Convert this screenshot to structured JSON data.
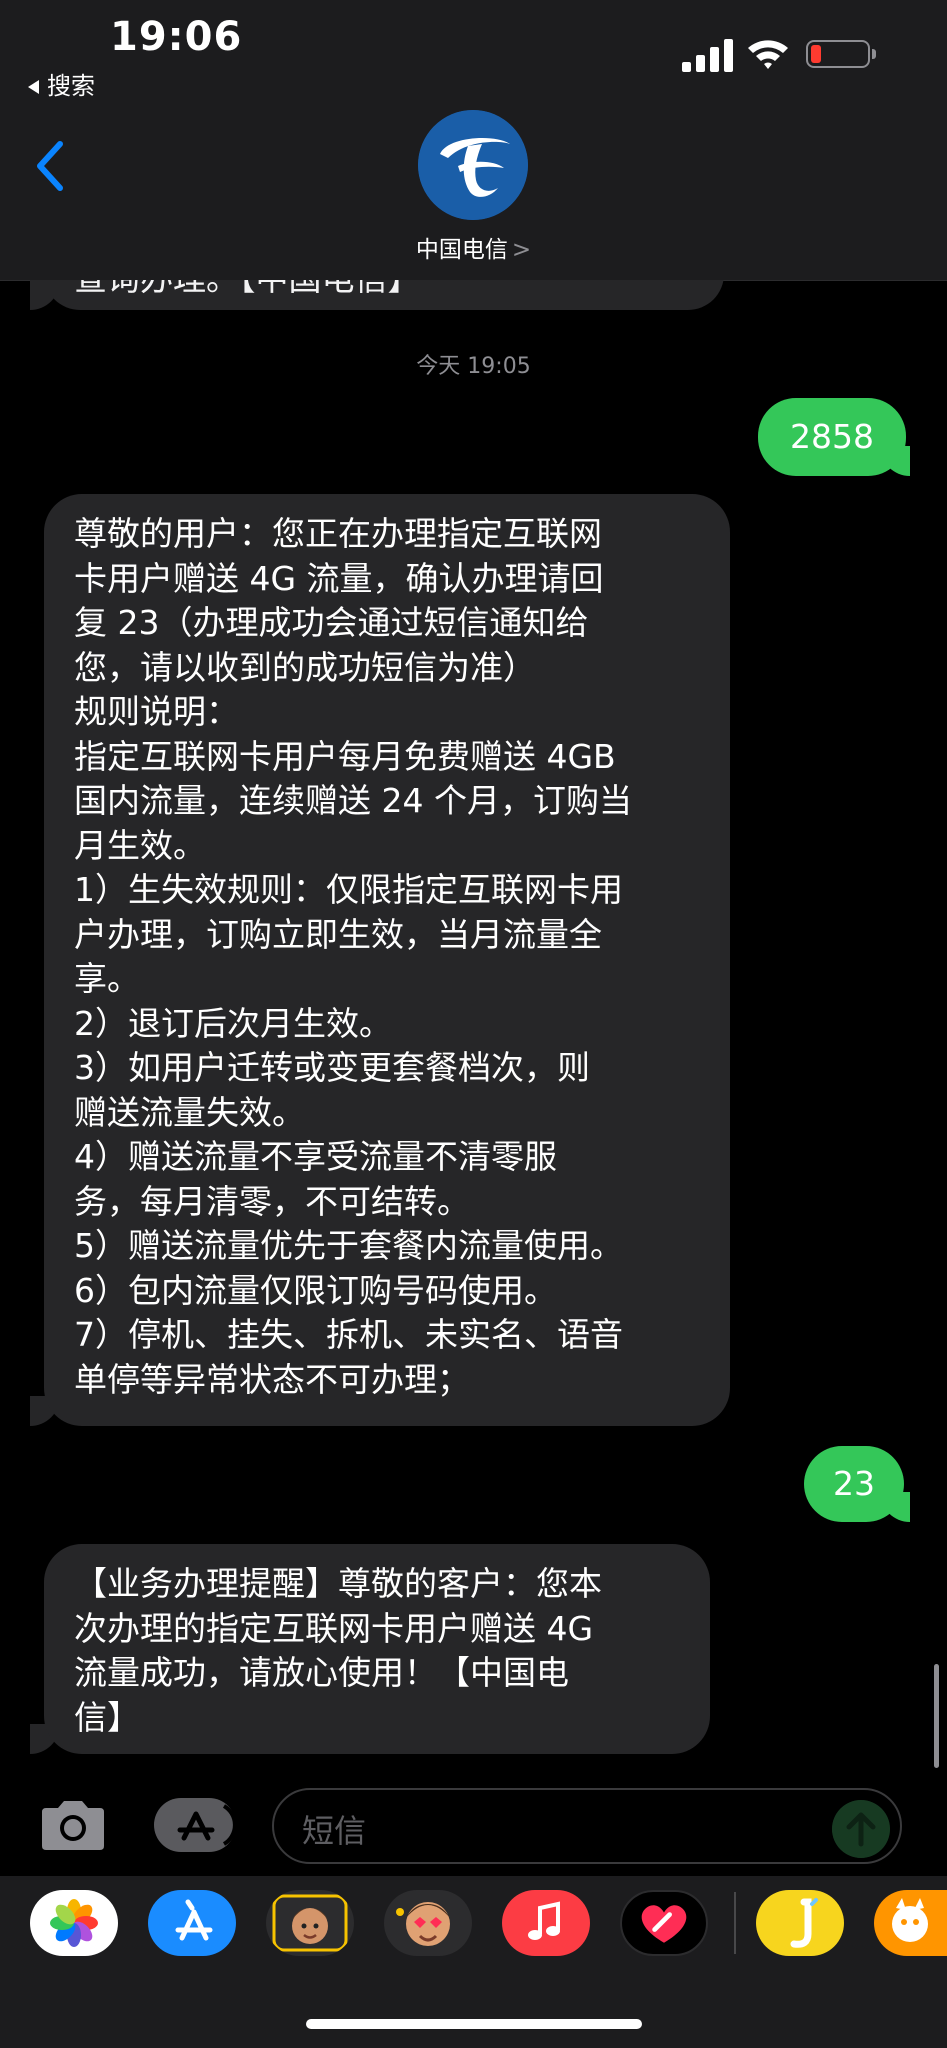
{
  "status_bar": {
    "time": "19:06",
    "back_app": "搜索"
  },
  "header": {
    "contact_name": "中国电信",
    "contact_chevron": ">"
  },
  "conversation": {
    "previous_fragment": "查询办理。【中国电信】",
    "timestamp": "今天 19:05",
    "messages": [
      {
        "direction": "outgoing",
        "text": "2858"
      },
      {
        "direction": "incoming",
        "lines": [
          "尊敬的用户：您正在办理指定互联网",
          "卡用户赠送 4G 流量，确认办理请回",
          "复 23（办理成功会通过短信通知给",
          "您，请以收到的成功短信为准）",
          "规则说明：",
          "指定互联网卡用户每月免费赠送 4GB",
          "国内流量，连续赠送 24 个月，订购当",
          "月生效。",
          "1）生失效规则：仅限指定互联网卡用",
          "户办理，订购立即生效，当月流量全",
          "享。",
          "2）退订后次月生效。",
          "3）如用户迁转或变更套餐档次，则",
          "赠送流量失效。",
          "4）赠送流量不享受流量不清零服",
          "务，每月清零，不可结转。",
          "5）赠送流量优先于套餐内流量使用。",
          "6）包内流量仅限订购号码使用。",
          "7）停机、挂失、拆机、未实名、语音",
          "单停等异常状态不可办理；"
        ]
      },
      {
        "direction": "outgoing",
        "text": "23"
      },
      {
        "direction": "incoming",
        "lines": [
          "【业务办理提醒】尊敬的客户：您本",
          "次办理的指定互联网卡用户赠送 4G",
          "流量成功，请放心使用！【中国电",
          "信】"
        ]
      }
    ]
  },
  "input_bar": {
    "placeholder": "短信"
  },
  "app_drawer": {
    "apps": [
      "photos-icon",
      "app-store-icon",
      "memoji-icon",
      "animoji-icon",
      "music-icon",
      "digital-touch-icon",
      "sticker-app-icon",
      "animal-sticker-icon"
    ]
  },
  "colors": {
    "outgoing_bubble": "#34c759",
    "incoming_bubble": "#262628",
    "accent": "#0a84ff",
    "battery_low": "#ff3b30"
  }
}
